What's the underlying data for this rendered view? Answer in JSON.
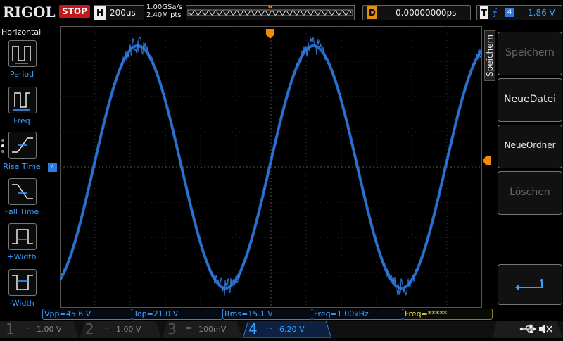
{
  "brand": "RIGOL",
  "run_state": "STOP",
  "horizontal": {
    "key": "H",
    "timebase": "200us",
    "sample_rate": "1.00GSa/s",
    "points": "2.40M pts"
  },
  "trigger_position_marker": "T",
  "delay": {
    "key": "D",
    "value": "0.00000000ps"
  },
  "trigger": {
    "key": "T",
    "edge_icon": "rising-edge-icon",
    "channel": "4",
    "level": "1.86 V"
  },
  "left_menu": {
    "title": "Horizontal",
    "items": [
      {
        "label": "Period",
        "icon": "period-icon"
      },
      {
        "label": "Freq",
        "icon": "freq-icon"
      },
      {
        "label": "Rise Time",
        "icon": "rise-time-icon"
      },
      {
        "label": "Fall Time",
        "icon": "fall-time-icon"
      },
      {
        "label": "+Width",
        "icon": "pos-width-icon"
      },
      {
        "label": "-Width",
        "icon": "neg-width-icon"
      }
    ]
  },
  "channel_marker": "4",
  "right_menu": {
    "title": "Speichern",
    "items": [
      {
        "label": "Speichern",
        "enabled": false
      },
      {
        "label": "NeueDatei",
        "enabled": true
      },
      {
        "label": "NeueOrdner",
        "enabled": true
      },
      {
        "label": "Löschen",
        "enabled": false
      }
    ],
    "back_icon": "return-arrow-icon"
  },
  "measurements": [
    "Vpp=45.6 V",
    "Top=21.0 V",
    "Rms=15.1 V",
    "Freq=1.00kHz",
    "Freq=*****"
  ],
  "channels": [
    {
      "num": "1",
      "coupling": "~",
      "scale": "1.00 V",
      "active": false
    },
    {
      "num": "2",
      "coupling": "~",
      "scale": "1.00 V",
      "active": false
    },
    {
      "num": "3",
      "coupling": "=",
      "scale": "100mV",
      "active": false
    },
    {
      "num": "4",
      "coupling": "~",
      "scale": "6.20 V",
      "active": true
    }
  ],
  "status_icons": [
    "usb-icon",
    "speaker-muted-icon"
  ],
  "colors": {
    "ch4": "#2e7be0",
    "stop": "#c21a1a",
    "trigger_marker": "#f08a10",
    "grid": "#3a3a3a"
  }
}
